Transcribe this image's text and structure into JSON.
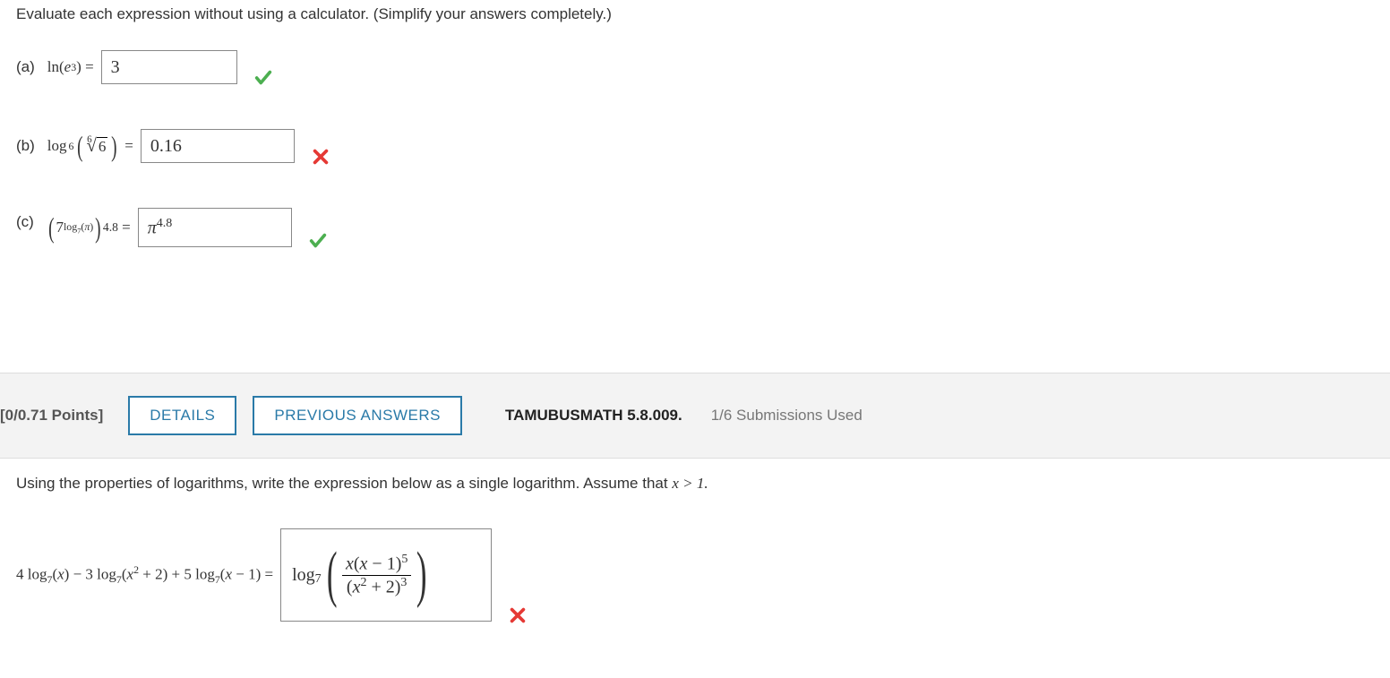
{
  "q1": {
    "instruction": "Evaluate each expression without using a calculator. (Simplify your answers completely.)",
    "parts": {
      "a": {
        "label": "(a)",
        "answer": "3",
        "status": "correct"
      },
      "b": {
        "label": "(b)",
        "answer": "0.16",
        "status": "incorrect"
      },
      "c": {
        "label": "(c)",
        "answer_base": "π",
        "answer_exp": "4.8",
        "status": "correct"
      }
    }
  },
  "header": {
    "points": "[0/0.71 Points]",
    "details_label": "DETAILS",
    "previous_label": "PREVIOUS ANSWERS",
    "source": "TAMUBUSMATH 5.8.009.",
    "submissions": "1/6 Submissions Used"
  },
  "q2": {
    "instruction_prefix": "Using the properties of logarithms, write the expression below as a single logarithm. Assume that ",
    "instruction_condition": "x > 1.",
    "status": "incorrect"
  }
}
